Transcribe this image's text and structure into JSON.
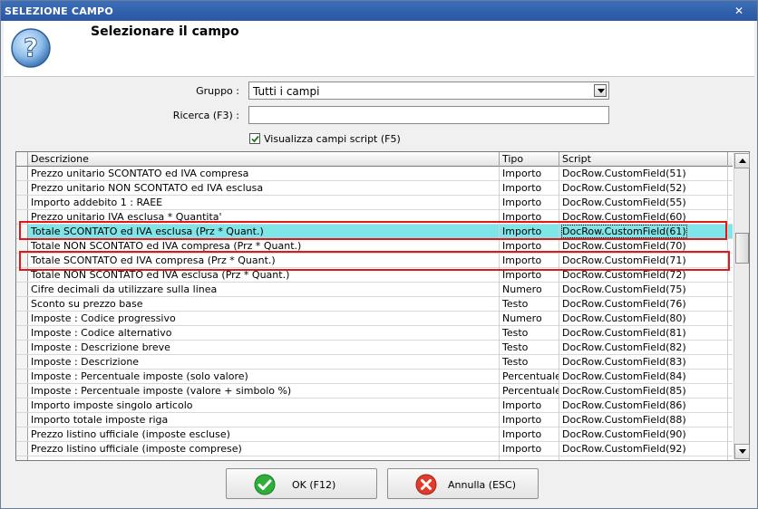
{
  "window": {
    "title": "SELEZIONE CAMPO",
    "close_label": "✕"
  },
  "header": {
    "title": "Selezionare il campo",
    "icon": "question-icon"
  },
  "form": {
    "gruppo_label": "Gruppo :",
    "gruppo_value": "Tutti i campi",
    "ricerca_label": "Ricerca (F3) :",
    "ricerca_value": "",
    "checkbox_label": "Visualizza campi script (F5)",
    "checkbox_checked": true
  },
  "grid": {
    "columns": {
      "descrizione": "Descrizione",
      "tipo": "Tipo",
      "script": "Script"
    },
    "rows": [
      {
        "desc": "Prezzo unitario SCONTATO ed IVA compresa",
        "tipo": "Importo",
        "script": "DocRow.CustomField(51)"
      },
      {
        "desc": "Prezzo unitario NON SCONTATO ed IVA esclusa",
        "tipo": "Importo",
        "script": "DocRow.CustomField(52)"
      },
      {
        "desc": "Importo addebito 1 : RAEE",
        "tipo": "Importo",
        "script": "DocRow.CustomField(55)"
      },
      {
        "desc": "Prezzo unitario IVA esclusa * Quantita'",
        "tipo": "Importo",
        "script": "DocRow.CustomField(60)"
      },
      {
        "desc": "Totale SCONTATO ed IVA esclusa (Prz * Quant.)",
        "tipo": "Importo",
        "script": "DocRow.CustomField(61)"
      },
      {
        "desc": "Totale NON SCONTATO ed IVA compresa (Prz * Quant.)",
        "tipo": "Importo",
        "script": "DocRow.CustomField(70)"
      },
      {
        "desc": "Totale SCONTATO ed IVA compresa (Prz * Quant.)",
        "tipo": "Importo",
        "script": "DocRow.CustomField(71)"
      },
      {
        "desc": "Totale NON SCONTATO ed IVA esclusa (Prz * Quant.)",
        "tipo": "Importo",
        "script": "DocRow.CustomField(72)"
      },
      {
        "desc": "Cifre decimali da utilizzare sulla linea",
        "tipo": "Numero",
        "script": "DocRow.CustomField(75)"
      },
      {
        "desc": "Sconto su prezzo base",
        "tipo": "Testo",
        "script": "DocRow.CustomField(76)"
      },
      {
        "desc": "Imposte : Codice progressivo",
        "tipo": "Numero",
        "script": "DocRow.CustomField(80)"
      },
      {
        "desc": "Imposte : Codice alternativo",
        "tipo": "Testo",
        "script": "DocRow.CustomField(81)"
      },
      {
        "desc": "Imposte : Descrizione breve",
        "tipo": "Testo",
        "script": "DocRow.CustomField(82)"
      },
      {
        "desc": "Imposte : Descrizione",
        "tipo": "Testo",
        "script": "DocRow.CustomField(83)"
      },
      {
        "desc": "Imposte : Percentuale imposte (solo valore)",
        "tipo": "Percentuale",
        "script": "DocRow.CustomField(84)"
      },
      {
        "desc": "Imposte : Percentuale imposte (valore + simbolo %)",
        "tipo": "Percentuale",
        "script": "DocRow.CustomField(85)"
      },
      {
        "desc": "Importo imposte singolo articolo",
        "tipo": "Importo",
        "script": "DocRow.CustomField(86)"
      },
      {
        "desc": "Importo totale imposte riga",
        "tipo": "Importo",
        "script": "DocRow.CustomField(88)"
      },
      {
        "desc": "Prezzo listino ufficiale (imposte escluse)",
        "tipo": "Importo",
        "script": "DocRow.CustomField(90)"
      },
      {
        "desc": "Prezzo listino ufficiale (imposte comprese)",
        "tipo": "Importo",
        "script": "DocRow.CustomField(92)"
      },
      {
        "desc": "",
        "tipo": "",
        "script": ""
      }
    ]
  },
  "buttons": {
    "ok_label": "OK (F12)",
    "cancel_label": "Annulla (ESC)"
  },
  "colors": {
    "selected_row": "#7fe5e8",
    "highlight_box": "#e01818",
    "titlebar": "#2a56a3"
  }
}
